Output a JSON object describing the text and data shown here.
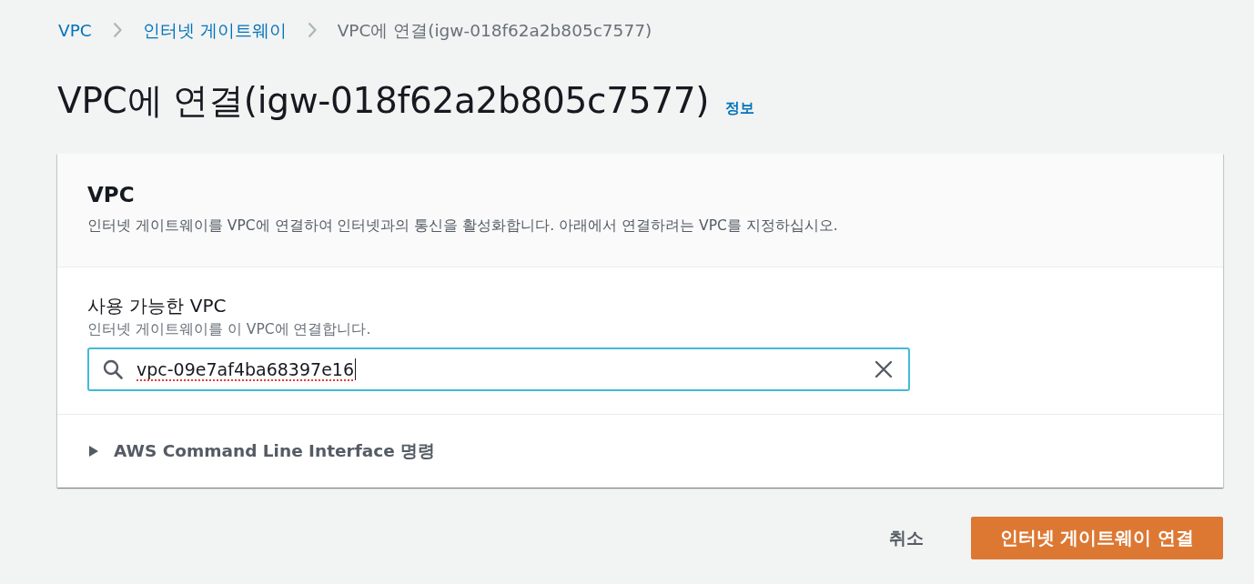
{
  "breadcrumbs": [
    {
      "label": "VPC",
      "kind": "link"
    },
    {
      "label": "인터넷 게이트웨이",
      "kind": "link"
    },
    {
      "label": "VPC에 연결(igw-018f62a2b805c7577)",
      "kind": "current"
    }
  ],
  "page_title": "VPC에 연결(igw-018f62a2b805c7577)",
  "info_link": "정보",
  "panel": {
    "title": "VPC",
    "description": "인터넷 게이트웨이를 VPC에 연결하여 인터넷과의 통신을 활성화합니다. 아래에서 연결하려는 VPC를 지정하십시오.",
    "field": {
      "label": "사용 가능한 VPC",
      "hint": "인터넷 게이트웨이를 이 VPC에 연결합니다.",
      "value": "vpc-09e7af4ba68397e16",
      "focused": true,
      "misspelled": true
    },
    "expander": {
      "label": "AWS Command Line Interface 명령",
      "expanded": false
    }
  },
  "buttons": [
    {
      "label": "취소",
      "kind": "link"
    },
    {
      "label": "인터넷 게이트웨이 연결",
      "kind": "primary"
    }
  ]
}
